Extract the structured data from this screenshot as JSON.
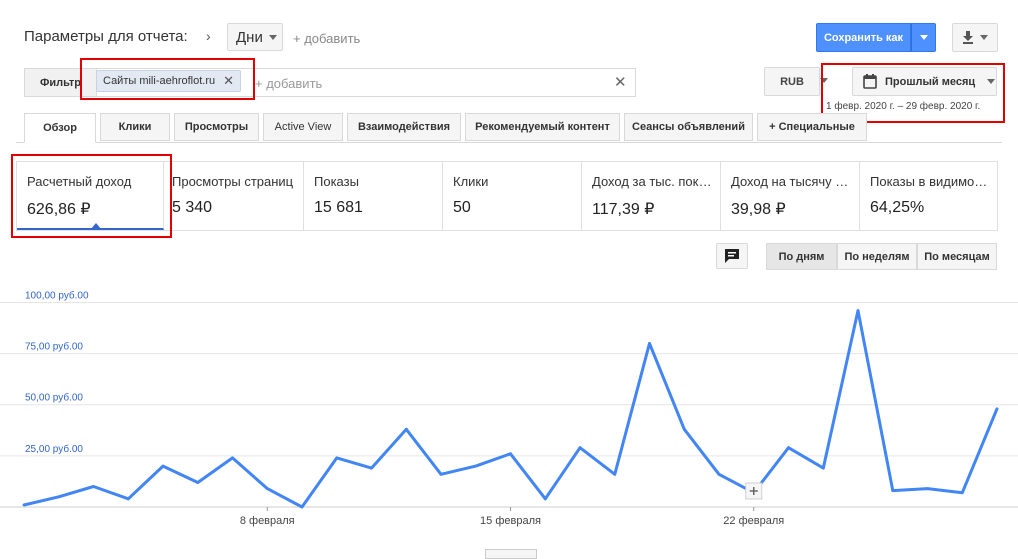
{
  "header": {
    "title": "Параметры для отчета:",
    "granularity": "Дни",
    "add_label": "+ добавить",
    "save_label": "Сохранить как"
  },
  "filter": {
    "label": "Фильтр",
    "chip": "Сайты mili-aehroflot.ru",
    "add_placeholder": "+ добавить"
  },
  "currency": "RUB",
  "period": {
    "label": "Прошлый месяц",
    "range": "1 февр. 2020 г. – 29 февр. 2020 г."
  },
  "tabs": [
    {
      "label": "Обзор"
    },
    {
      "label": "Клики"
    },
    {
      "label": "Просмотры"
    },
    {
      "label": "Active View"
    },
    {
      "label": "Взаимодействия"
    },
    {
      "label": "Рекомендуемый контент"
    },
    {
      "label": "Сеансы объявлений"
    },
    {
      "label": "+  Специальные"
    }
  ],
  "metrics": [
    {
      "label": "Расчетный доход",
      "value": "626,86 ₽"
    },
    {
      "label": "Просмотры страниц",
      "value": "5 340"
    },
    {
      "label": "Показы",
      "value": "15 681"
    },
    {
      "label": "Клики",
      "value": "50"
    },
    {
      "label": "Доход за тыс. показов",
      "value": "117,39 ₽"
    },
    {
      "label": "Доход на тысячу показов",
      "value": "39,98 ₽"
    },
    {
      "label": "Показы в видимой области",
      "value": "64,25%"
    }
  ],
  "view_toggle": {
    "day": "По дням",
    "week": "По неделям",
    "month": "По месяцам"
  },
  "icons": {
    "annotation": "comment-icon",
    "download": "download-icon",
    "calendar": "calendar-icon"
  },
  "colors": {
    "accent": "#4d90fe",
    "series": "#4285f4",
    "highlight": "#e30000"
  },
  "chart_data": {
    "type": "line",
    "title": "",
    "xlabel": "",
    "ylabel": "",
    "ylim": [
      0,
      110
    ],
    "yticks": [
      25,
      50,
      75,
      100
    ],
    "ytick_labels": [
      "25,00 руб.00",
      "50,00 руб.00",
      "75,00 руб.00",
      "100,00 руб.00"
    ],
    "x": [
      "1",
      "2",
      "3",
      "4",
      "5",
      "6",
      "7",
      "8",
      "9",
      "10",
      "11",
      "12",
      "13",
      "14",
      "15",
      "16",
      "17",
      "18",
      "19",
      "20",
      "21",
      "22",
      "23",
      "24",
      "25",
      "26",
      "27",
      "28",
      "29"
    ],
    "xtick_labels": [
      {
        "index": 7,
        "label": "8 февраля"
      },
      {
        "index": 14,
        "label": "15 февраля"
      },
      {
        "index": 21,
        "label": "22 февраля"
      }
    ],
    "series": [
      {
        "name": "Расчетный доход",
        "values": [
          1,
          5,
          10,
          4,
          20,
          12,
          24,
          9,
          0,
          24,
          19,
          38,
          16,
          20,
          26,
          4,
          29,
          16,
          80,
          38,
          16,
          7,
          29,
          19,
          96,
          8,
          9,
          7,
          48
        ]
      }
    ]
  }
}
